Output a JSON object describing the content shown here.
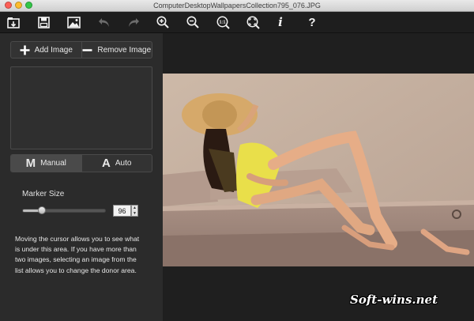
{
  "window": {
    "title": "ComputerDesktopWallpapersCollection795_076.JPG"
  },
  "toolbar": {
    "items": [
      {
        "name": "open-icon",
        "enabled": true
      },
      {
        "name": "save-icon",
        "enabled": true
      },
      {
        "name": "image-icon",
        "enabled": true
      },
      {
        "name": "undo-icon",
        "enabled": false
      },
      {
        "name": "redo-icon",
        "enabled": false
      },
      {
        "name": "zoom-in-icon",
        "enabled": true
      },
      {
        "name": "zoom-out-icon",
        "enabled": true
      },
      {
        "name": "actual-size-icon",
        "label": "1:1",
        "enabled": true
      },
      {
        "name": "fit-icon",
        "enabled": true
      },
      {
        "name": "info-icon",
        "label": "i",
        "enabled": true
      },
      {
        "name": "help-icon",
        "label": "?",
        "enabled": true
      }
    ]
  },
  "sidebar": {
    "add_image": "Add Image",
    "remove_image": "Remove Image",
    "mode": {
      "manual_icon": "M",
      "manual_label": "Manual",
      "auto_icon": "A",
      "auto_label": "Auto",
      "selected": "Manual"
    },
    "marker_size": {
      "label": "Marker Size",
      "value": "96",
      "slider_fraction": 0.23
    },
    "help_text": "Moving the cursor allows you to see what is under this area. If you have more than two images, selecting an image from the list allows you to change the donor area."
  },
  "watermark": "Soft-wins.net",
  "colors": {
    "panel": "#2b2b2b",
    "toolbar": "#1e1e1e",
    "canvas": "#1f1f1f"
  }
}
